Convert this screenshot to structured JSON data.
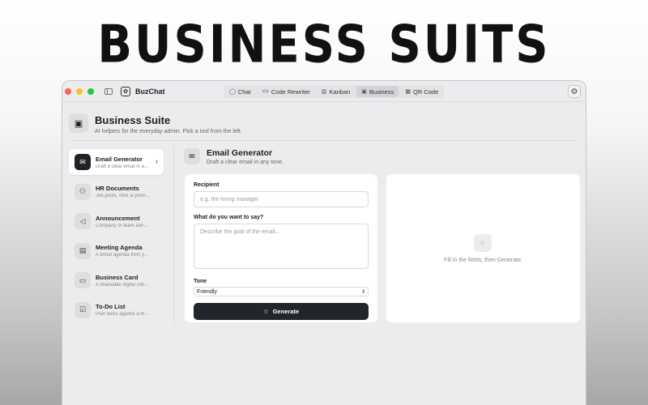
{
  "headline": "BUSINESS SUITS",
  "app": {
    "name": "BuzChat"
  },
  "tabs": [
    {
      "label": "Chat",
      "icon": "chat-bubble-icon"
    },
    {
      "label": "Code Rewriter",
      "icon": "code-icon"
    },
    {
      "label": "Kanban",
      "icon": "kanban-icon"
    },
    {
      "label": "Business",
      "icon": "briefcase-icon",
      "active": true
    },
    {
      "label": "QR Code",
      "icon": "qr-icon"
    }
  ],
  "suite": {
    "title": "Business Suite",
    "subtitle": "AI helpers for the everyday admin. Pick a tool from the left."
  },
  "tools": [
    {
      "name": "Email Generator",
      "desc": "Draft a clear email in any tone.",
      "active": true
    },
    {
      "name": "HR Documents",
      "desc": "Job posts, offer & promotion letters"
    },
    {
      "name": "Announcement",
      "desc": "Company or team announcements"
    },
    {
      "name": "Meeting Agenda",
      "desc": "A timed agenda from your notes"
    },
    {
      "name": "Business Card",
      "desc": "A shareable digital contact card"
    },
    {
      "name": "To-Do List",
      "desc": "Plan tasks against a month"
    }
  ],
  "generator": {
    "title": "Email Generator",
    "subtitle": "Draft a clear email in any tone.",
    "recipient_label": "Recipient",
    "recipient_placeholder": "e.g. the hiring manager",
    "message_label": "What do you want to say?",
    "message_placeholder": "Describe the goal of the email...",
    "tone_label": "Tone",
    "tone_value": "Friendly",
    "generate_label": "Generate"
  },
  "output": {
    "empty_text": "Fill in the fields, then Generate."
  },
  "colors": {
    "accent_dark": "#22252b",
    "close": "#ff5f57",
    "minimize": "#febc2e",
    "zoom": "#28c840"
  }
}
